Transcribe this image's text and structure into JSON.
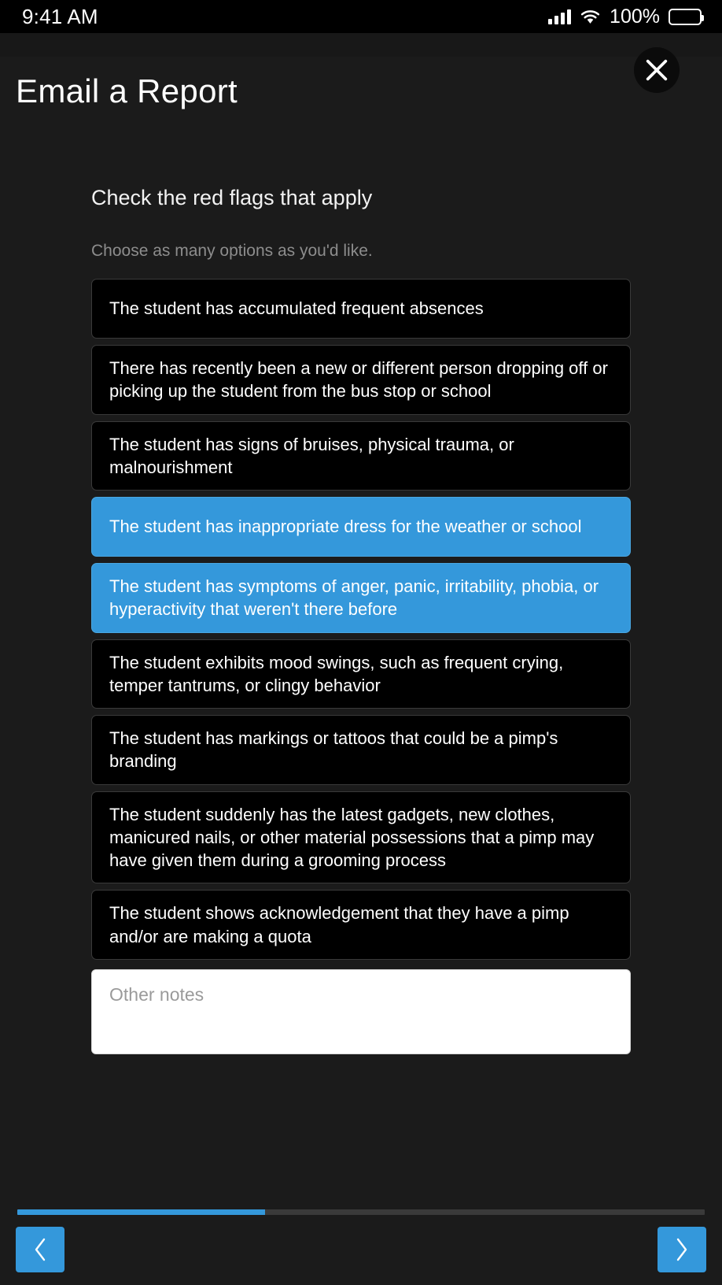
{
  "status_bar": {
    "time": "9:41 AM",
    "battery_percent": "100%",
    "signal_icon": "cellular-signal-icon",
    "wifi_icon": "wifi-icon",
    "battery_icon": "battery-full-icon"
  },
  "header": {
    "title": "Email a Report",
    "close_icon": "close-x-icon"
  },
  "question": {
    "title": "Check the red flags that apply",
    "subtitle": "Choose as many options as you'd like."
  },
  "options": [
    {
      "label": "The student has accumulated frequent absences",
      "selected": false
    },
    {
      "label": "There has recently been a new or different person dropping off or picking up the student from the bus stop or school",
      "selected": false
    },
    {
      "label": "The student has signs of bruises, physical trauma, or malnourishment",
      "selected": false
    },
    {
      "label": "The student has inappropriate dress for the weather or school",
      "selected": true
    },
    {
      "label": "The student has symptoms of anger, panic, irritability, phobia, or hyperactivity that weren't there before",
      "selected": true
    },
    {
      "label": "The student exhibits mood swings, such as frequent crying, temper tantrums, or clingy behavior",
      "selected": false
    },
    {
      "label": "The student has markings or tattoos that could be a pimp's branding",
      "selected": false
    },
    {
      "label": "The student suddenly has the latest gadgets, new clothes, manicured nails, or other material possessions that a pimp may have given them during a grooming process",
      "selected": false
    },
    {
      "label": "The student shows acknowledgement that they have a pimp and/or are making a quota",
      "selected": false
    }
  ],
  "notes": {
    "placeholder": "Other notes",
    "value": ""
  },
  "footer": {
    "progress_percent": 36,
    "prev_icon": "chevron-left-icon",
    "next_icon": "chevron-right-icon"
  },
  "colors": {
    "accent": "#3498db",
    "background": "#1b1b1b",
    "card": "#000000",
    "card_border": "#3a3a3a",
    "text": "#ffffff",
    "muted_text": "#8d8d8d"
  }
}
